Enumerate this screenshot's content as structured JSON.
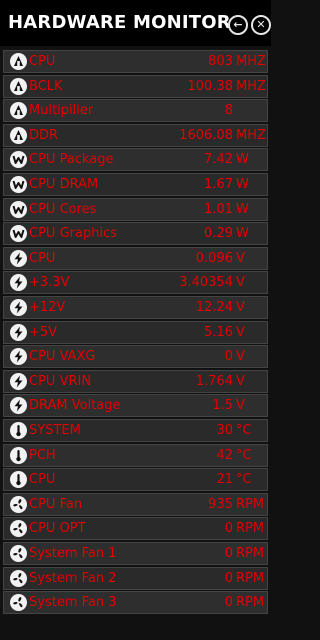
{
  "header": {
    "title": "HARDWARE MONITOR"
  },
  "rows": [
    {
      "icon": "chip-icon",
      "label": "CPU",
      "value": "803",
      "unit": "MHZ"
    },
    {
      "icon": "chip-icon",
      "label": "BCLK",
      "value": "100.38",
      "unit": "MHZ"
    },
    {
      "icon": "chip-icon",
      "label": "Multipilier",
      "value": "8",
      "unit": ""
    },
    {
      "icon": "chip-icon",
      "label": "DDR",
      "value": "1606.08",
      "unit": "MHZ"
    },
    {
      "icon": "power-w-icon",
      "label": "CPU Package",
      "value": "7.42",
      "unit": "W"
    },
    {
      "icon": "power-w-icon",
      "label": "CPU DRAM",
      "value": "1.67",
      "unit": "W"
    },
    {
      "icon": "power-w-icon",
      "label": "CPU Cores",
      "value": "1.01",
      "unit": "W"
    },
    {
      "icon": "power-w-icon",
      "label": "CPU Graphics",
      "value": "0.29",
      "unit": "W"
    },
    {
      "icon": "voltage-bolt-icon",
      "label": "CPU",
      "value": "0.096",
      "unit": "V"
    },
    {
      "icon": "voltage-bolt-icon",
      "label": "+3.3V",
      "value": "3.40354",
      "unit": "V"
    },
    {
      "icon": "voltage-bolt-icon",
      "label": "+12V",
      "value": "12.24",
      "unit": "V"
    },
    {
      "icon": "voltage-bolt-icon",
      "label": "+5V",
      "value": "5.16",
      "unit": "V"
    },
    {
      "icon": "voltage-bolt-icon",
      "label": "CPU VAXG",
      "value": "0",
      "unit": "V"
    },
    {
      "icon": "voltage-bolt-icon",
      "label": "CPU VRIN",
      "value": "1.764",
      "unit": "V"
    },
    {
      "icon": "voltage-bolt-icon",
      "label": "DRAM Voltage",
      "value": "1.5",
      "unit": "V"
    },
    {
      "icon": "thermometer-icon",
      "label": "SYSTEM",
      "value": "30",
      "unit": "°C"
    },
    {
      "icon": "thermometer-icon",
      "label": "PCH",
      "value": "42",
      "unit": "°C"
    },
    {
      "icon": "thermometer-icon",
      "label": "CPU",
      "value": "21",
      "unit": "°C"
    },
    {
      "icon": "fan-icon",
      "label": "CPU Fan",
      "value": "935",
      "unit": "RPM"
    },
    {
      "icon": "fan-icon",
      "label": "CPU OPT",
      "value": "0",
      "unit": "RPM"
    },
    {
      "icon": "fan-icon",
      "label": "System Fan 1",
      "value": "0",
      "unit": "RPM"
    },
    {
      "icon": "fan-icon",
      "label": "System Fan 2",
      "value": "0",
      "unit": "RPM"
    },
    {
      "icon": "fan-icon",
      "label": "System Fan 3",
      "value": "0",
      "unit": "RPM"
    }
  ],
  "colors": {
    "value_red": "#e30000",
    "header_bg": "#000000",
    "row_bg": "#2a2a2a"
  }
}
